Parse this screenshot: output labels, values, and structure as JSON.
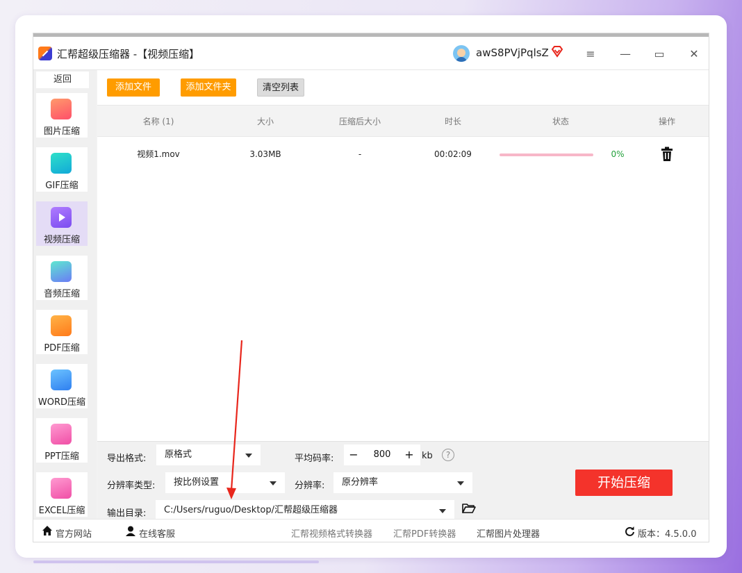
{
  "app": {
    "title": "汇帮超级压缩器 -【视频压缩】",
    "username": "awS8PVjPqlsZ",
    "window_buttons": {
      "menu": "≡",
      "minimize": "—",
      "maximize": "▭",
      "close": "✕"
    }
  },
  "sidebar": {
    "back": "返回",
    "items": [
      {
        "label": "图片压缩",
        "icon": "image-icon",
        "color": "#ff5a6e"
      },
      {
        "label": "GIF压缩",
        "icon": "gif-icon",
        "color": "#19c2d6"
      },
      {
        "label": "视频压缩",
        "icon": "video-icon",
        "color": "#8a5cf5"
      },
      {
        "label": "音频压缩",
        "icon": "audio-icon",
        "color": "#4bb6f0"
      },
      {
        "label": "PDF压缩",
        "icon": "pdf-icon",
        "color": "#ff8a1a"
      },
      {
        "label": "WORD压缩",
        "icon": "word-icon",
        "color": "#2f8cf0"
      },
      {
        "label": "PPT压缩",
        "icon": "ppt-icon",
        "color": "#f25aa8"
      },
      {
        "label": "EXCEL压缩",
        "icon": "excel-icon",
        "color": "#f25aa8"
      }
    ],
    "active_index": 2
  },
  "toolbar": {
    "add_file": "添加文件",
    "add_folder": "添加文件夹",
    "clear_list": "清空列表"
  },
  "table": {
    "headers": [
      "名称 (1)",
      "大小",
      "压缩后大小",
      "时长",
      "状态",
      "操作"
    ],
    "rows": [
      {
        "name": "视频1.mov",
        "size": "3.03MB",
        "compressed_size": "-",
        "duration": "00:02:09",
        "progress": "0%",
        "progress_value": 0
      }
    ]
  },
  "settings": {
    "export_format_label": "导出格式:",
    "export_format_value": "原格式",
    "bitrate_label": "平均码率:",
    "bitrate_value": "800",
    "bitrate_unit": "kb",
    "minus": "−",
    "plus": "+",
    "help": "?",
    "resolution_type_label": "分辨率类型:",
    "resolution_type_value": "按比例设置",
    "resolution_label": "分辨率:",
    "resolution_value": "原分辨率",
    "output_dir_label": "输出目录:",
    "output_dir_value": "C:/Users/ruguo/Desktop/汇帮超级压缩器",
    "start_button": "开始压缩"
  },
  "footer": {
    "website": "官方网站",
    "service": "在线客服",
    "video_converter": "汇帮视频格式转换器",
    "pdf_converter": "汇帮PDF转换器",
    "image_processor": "汇帮图片处理器",
    "version": "版本：4.5.0.0"
  },
  "colors": {
    "accent_orange": "#ff9c00",
    "start_red": "#f4332b",
    "progress_pink": "#f7b7c8",
    "percent_green": "#22a03a",
    "annotation_red": "#e8261c"
  }
}
